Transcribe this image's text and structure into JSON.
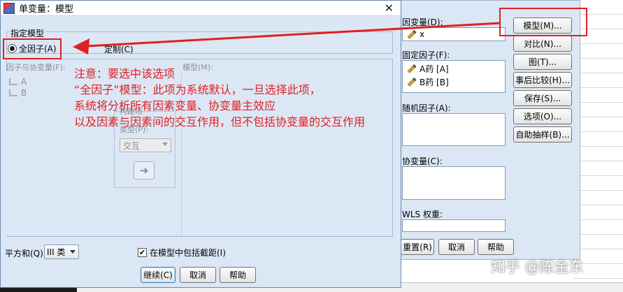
{
  "bg_dialog": {
    "dependent_label": "因变量(D):",
    "dependent_value": "x",
    "fixed_factors_label": "固定因子(F):",
    "fixed_factors": [
      "A药 [A]",
      "B药 [B]"
    ],
    "random_factors_label": "随机因子(A):",
    "covariates_label": "协变量(C):",
    "wls_label": "WLS 权重:",
    "buttons": {
      "model": "模型(M)...",
      "contrast": "对比(N)...",
      "plots": "图(T)...",
      "post_hoc": "事后比较(H)...",
      "save": "保存(S)...",
      "options": "选项(O)...",
      "bootstrap": "自助抽样(B)...",
      "reset": "重置(R)",
      "cancel": "取消",
      "help": "帮助"
    }
  },
  "dialog": {
    "title": "单变量：模型",
    "close_symbol": "✕",
    "specify_model_label": "指定模型",
    "full_factorial_label": "全因子(A)",
    "custom_label": "定制(C)",
    "factors_label": "因子与协变量(F):",
    "model_label": "模型(M):",
    "factors": [
      "A",
      "B"
    ],
    "build_term_label": "构建项",
    "type_label": "类型(P):",
    "type_value": "交互",
    "arrow_symbol": "➔",
    "sum_of_squares_label": "平方和(Q)",
    "sum_of_squares_value": "III 类",
    "include_intercept_label": "在模型中包括截距(I)",
    "include_intercept_checked": true,
    "check_symbol": "✔",
    "buttons": {
      "continue": "继续(C)",
      "cancel": "取消",
      "help": "帮助"
    }
  },
  "annotation": {
    "lines": [
      "注意：要选中该选项",
      "“全因子”模型：此项为系统默认，一旦选择此项，",
      "系统将分析所有因素变量、协变量主效应",
      "以及因素与因素间的交互作用，但不包括协变量的交互作用"
    ],
    "color": "#e02020"
  },
  "watermark": "知乎 @陈金东"
}
